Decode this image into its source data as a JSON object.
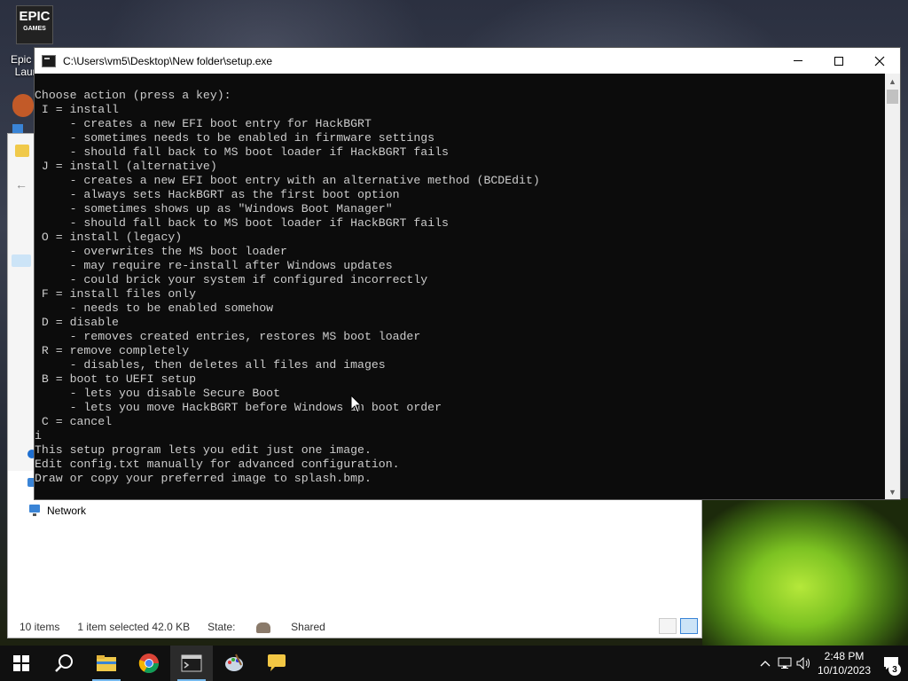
{
  "desktop": {
    "icons": [
      {
        "label": "Epic G Laun",
        "logo_top": "EPIC",
        "logo_bottom": "GAMES"
      }
    ]
  },
  "explorer": {
    "nav_item": "Network",
    "status": {
      "items_count": "10 items",
      "selection": "1 item selected  42.0 KB",
      "state_label": "State:",
      "state_value": "Shared"
    }
  },
  "console": {
    "title": "C:\\Users\\vm5\\Desktop\\New folder\\setup.exe",
    "lines": [
      "Choose action (press a key):",
      " I = install",
      "     - creates a new EFI boot entry for HackBGRT",
      "     - sometimes needs to be enabled in firmware settings",
      "     - should fall back to MS boot loader if HackBGRT fails",
      " J = install (alternative)",
      "     - creates a new EFI boot entry with an alternative method (BCDEdit)",
      "     - always sets HackBGRT as the first boot option",
      "     - sometimes shows up as \"Windows Boot Manager\"",
      "     - should fall back to MS boot loader if HackBGRT fails",
      " O = install (legacy)",
      "     - overwrites the MS boot loader",
      "     - may require re-install after Windows updates",
      "     - could brick your system if configured incorrectly",
      " F = install files only",
      "     - needs to be enabled somehow",
      " D = disable",
      "     - removes created entries, restores MS boot loader",
      " R = remove completely",
      "     - disables, then deletes all files and images",
      " B = boot to UEFI setup",
      "     - lets you disable Secure Boot",
      "     - lets you move HackBGRT before Windows in boot order",
      " C = cancel",
      "i",
      "This setup program lets you edit just one image.",
      "Edit config.txt manually for advanced configuration.",
      "Draw or copy your preferred image to splash.bmp."
    ]
  },
  "taskbar": {
    "clock_time": "2:48 PM",
    "clock_date": "10/10/2023",
    "notification_count": "3"
  },
  "colors": {
    "console_bg": "#0c0c0c",
    "console_text": "#cccccc",
    "taskbar_bg": "#101010",
    "accent": "#76b9ed"
  }
}
